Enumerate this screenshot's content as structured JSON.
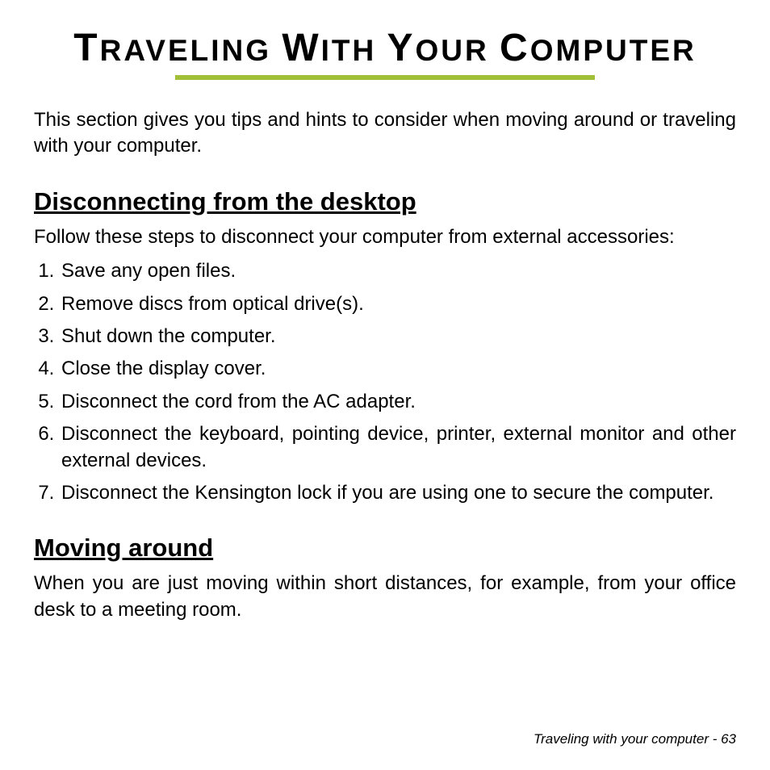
{
  "title_parts": {
    "t_cap": "T",
    "t_rest": "RAVELING",
    "w_cap": "W",
    "w_rest": "ITH",
    "y_cap": "Y",
    "y_rest": "OUR",
    "c_cap": "C",
    "c_rest": "OMPUTER"
  },
  "intro": "This section gives you tips and hints to consider when moving around or traveling with your computer.",
  "section1": {
    "heading": "Disconnecting from the desktop",
    "lead": "Follow these steps to disconnect your computer from external accessories:",
    "steps": [
      "Save any open files.",
      "Remove discs from optical drive(s).",
      "Shut down the computer.",
      "Close the display cover.",
      "Disconnect the cord from the AC adapter.",
      "Disconnect the keyboard, pointing device, printer, external monitor and other external devices.",
      "Disconnect the Kensington lock if you are using one to secure the computer."
    ]
  },
  "section2": {
    "heading": "Moving around",
    "body": "When you are just moving within short distances, for example, from your office desk to a meeting room."
  },
  "footer": "Traveling with your computer -  63"
}
